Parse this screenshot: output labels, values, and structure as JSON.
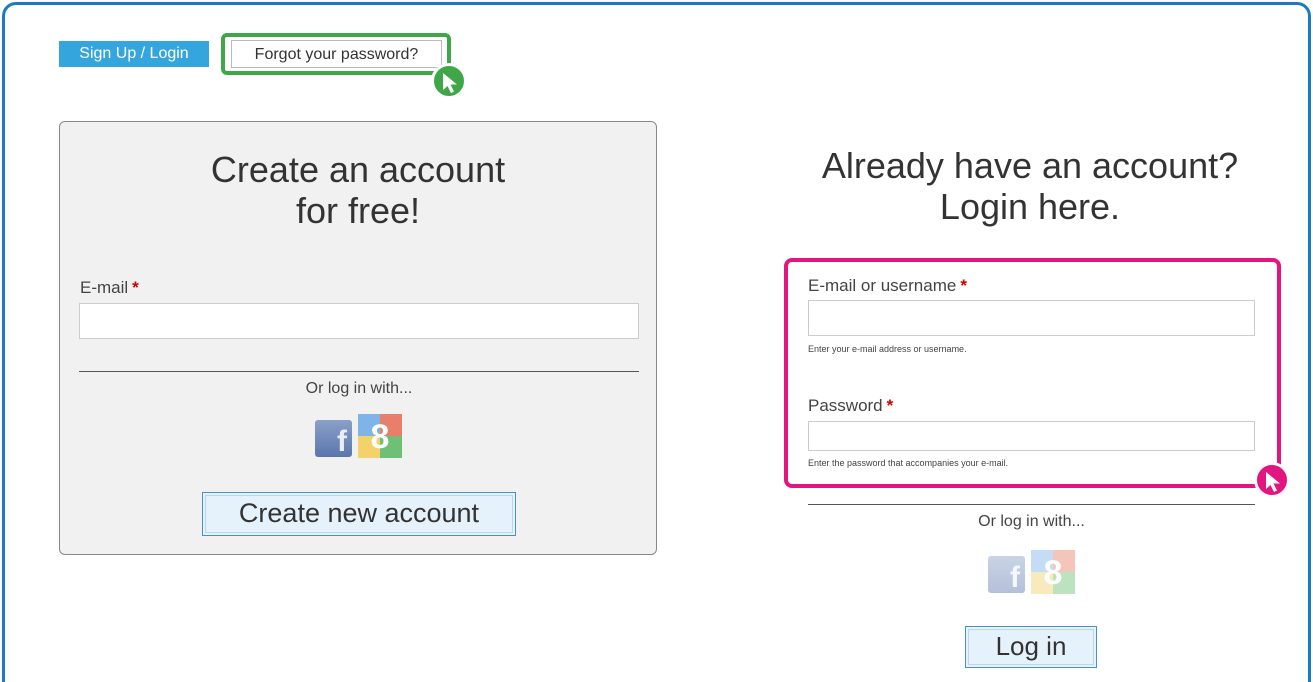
{
  "tabs": {
    "active_label": "Sign Up / Login",
    "forgot_label": "Forgot your password?"
  },
  "signup": {
    "title_line1": "Create an account",
    "title_line2": "for free!",
    "email_label": "E-mail",
    "required_mark": "*",
    "email_value": "",
    "or_text": "Or log in with...",
    "button_label": "Create new account"
  },
  "login": {
    "title_line1": "Already have an account?",
    "title_line2": "Login here.",
    "username_label": "E-mail or username",
    "username_help": "Enter your e-mail address or username.",
    "password_label": "Password",
    "password_help": "Enter the password that accompanies your e-mail.",
    "required_mark": "*",
    "or_text": "Or log in with...",
    "button_label": "Log in"
  },
  "social": {
    "facebook_icon": "facebook-icon",
    "google_icon": "google-icon"
  },
  "colors": {
    "frame": "#1a7bbf",
    "tab_active": "#35a6dd",
    "highlight_green": "#3fa748",
    "highlight_pink": "#e3157f",
    "required": "#cc0000"
  }
}
